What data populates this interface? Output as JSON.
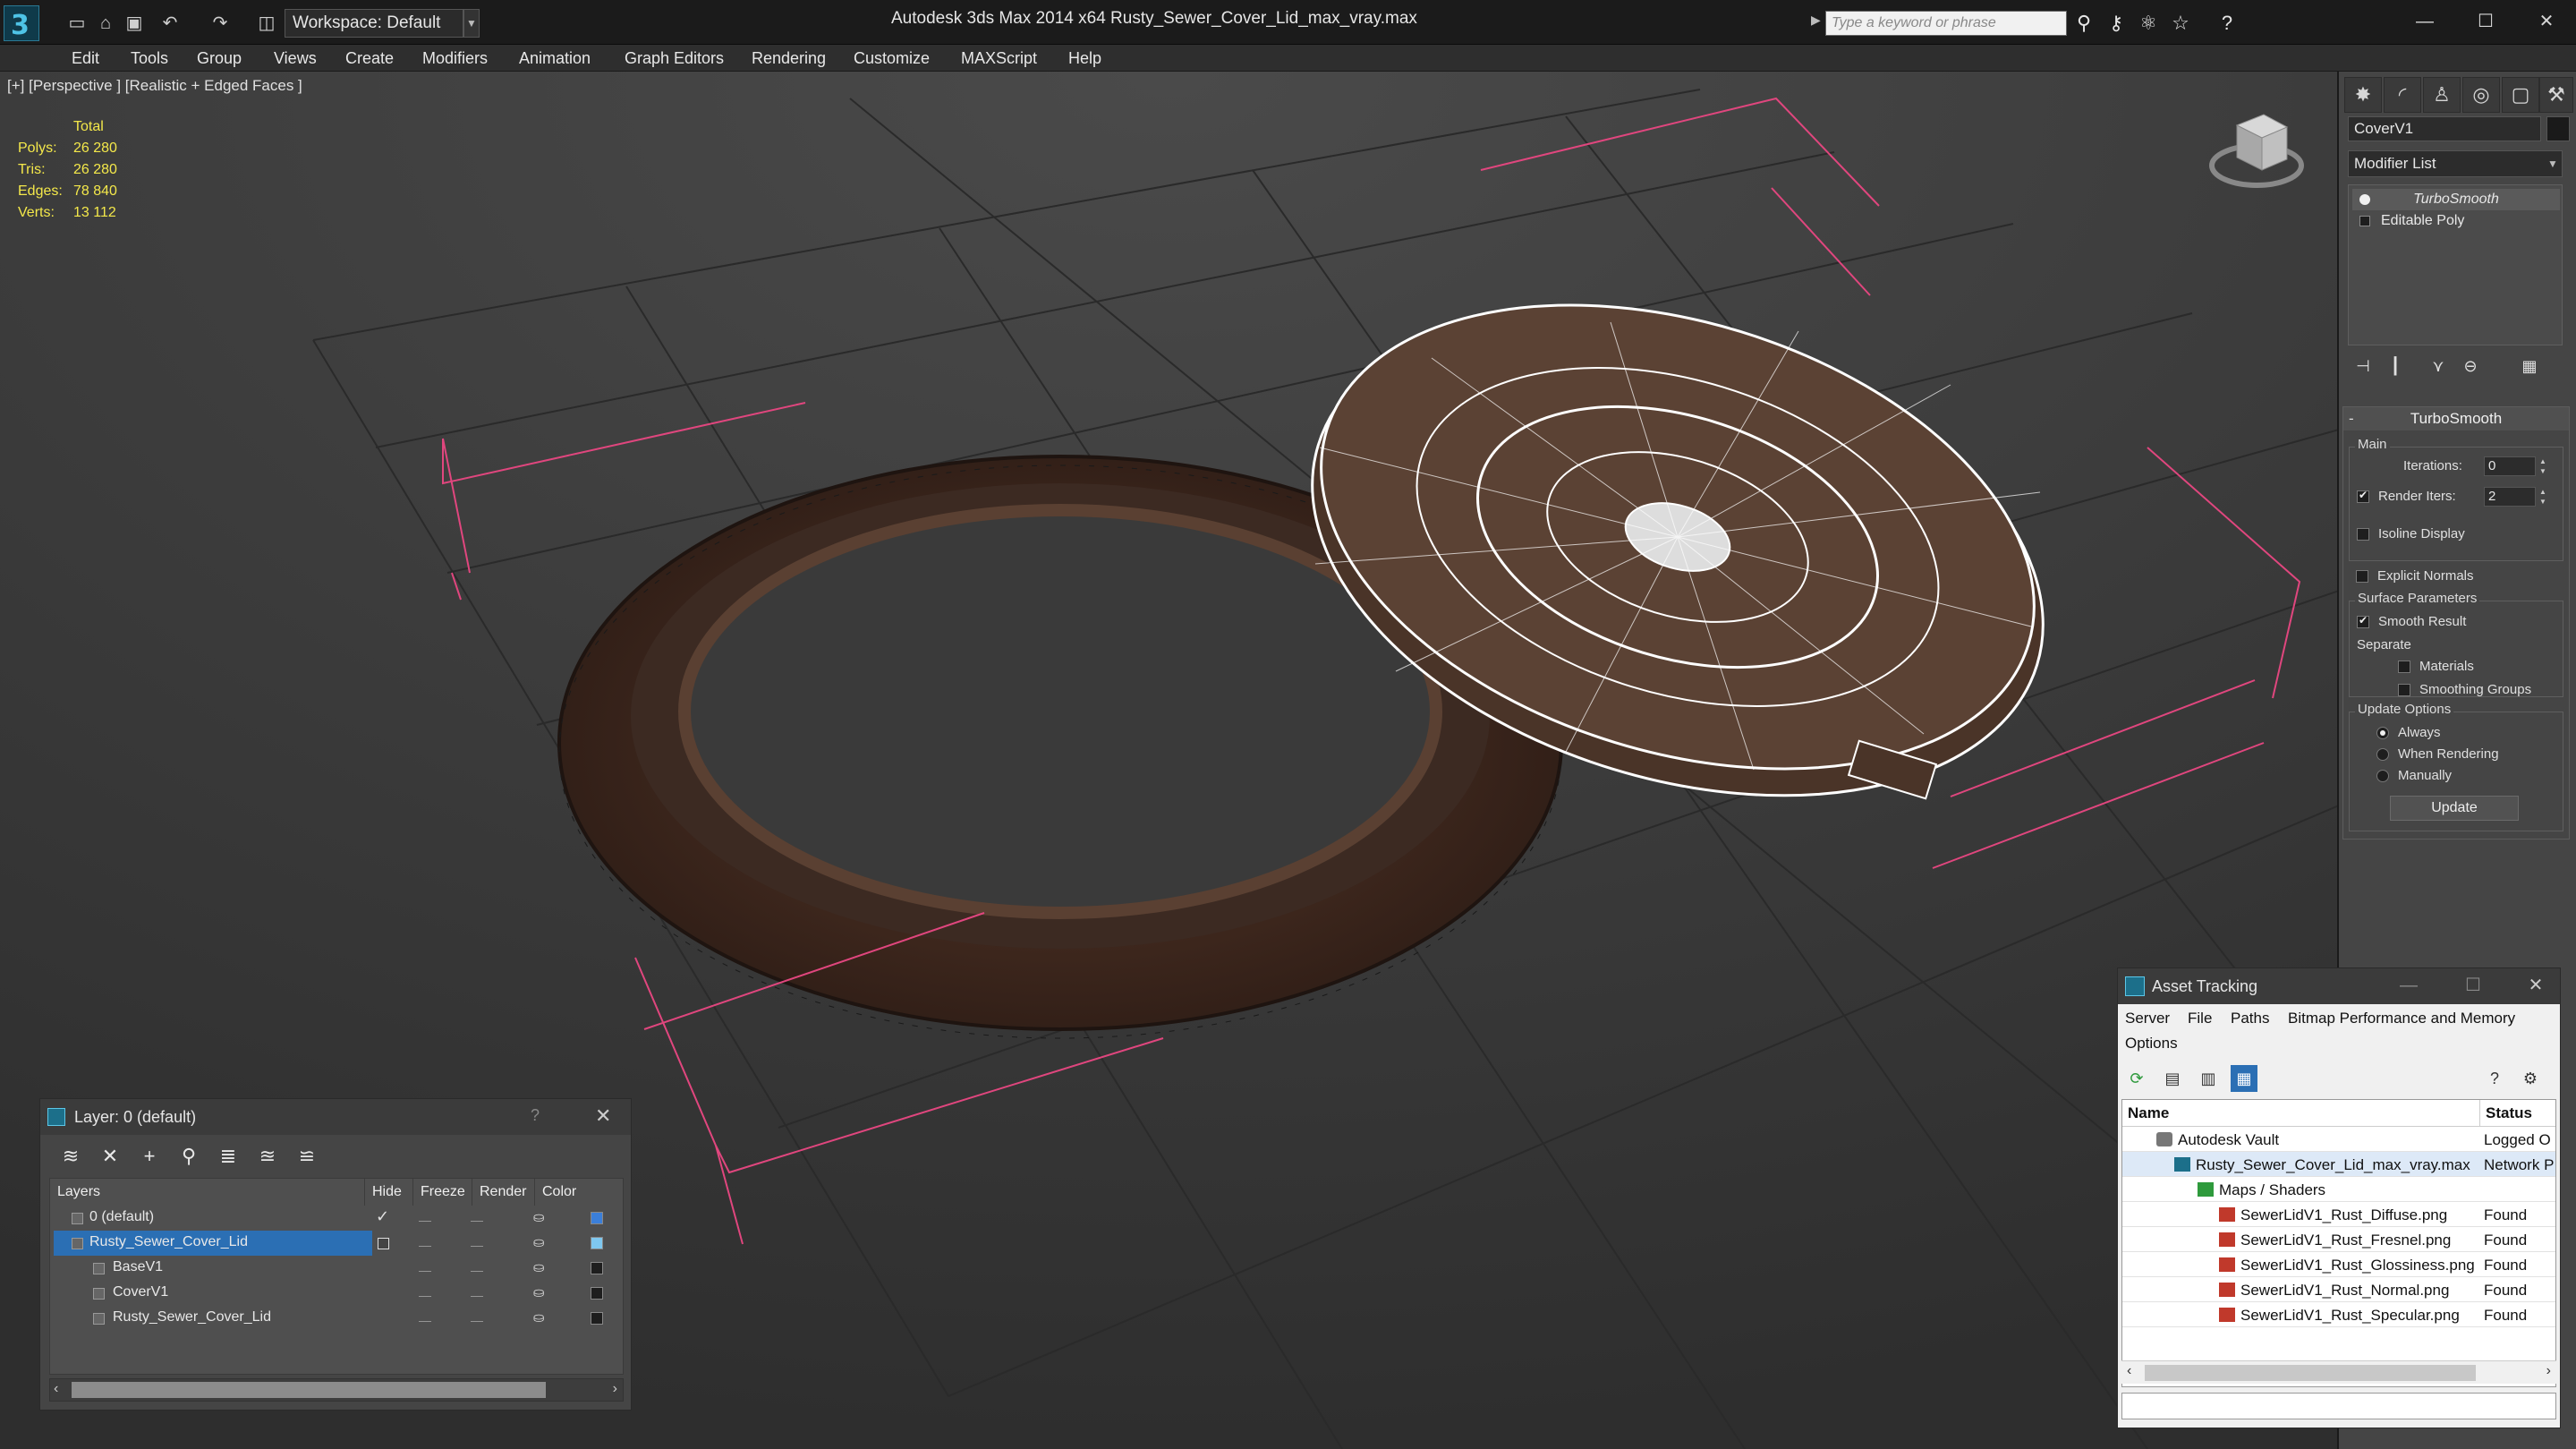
{
  "titlebar": {
    "workspace": "Workspace: Default",
    "app_title": "Autodesk 3ds Max  2014 x64      Rusty_Sewer_Cover_Lid_max_vray.max",
    "search_placeholder": "Type a keyword or phrase"
  },
  "menu": [
    "Edit",
    "Tools",
    "Group",
    "Views",
    "Create",
    "Modifiers",
    "Animation",
    "Graph Editors",
    "Rendering",
    "Customize",
    "MAXScript",
    "Help"
  ],
  "viewport": {
    "label": "[+] [Perspective ] [Realistic + Edged Faces ]",
    "stats": {
      "header": "Total",
      "rows": [
        {
          "key": "Polys:",
          "value": "26 280"
        },
        {
          "key": "Tris:",
          "value": "26 280"
        },
        {
          "key": "Edges:",
          "value": "78 840"
        },
        {
          "key": "Verts:",
          "value": "13 112"
        }
      ]
    }
  },
  "command_panel": {
    "object_name": "CoverV1",
    "modifier_list": "Modifier List",
    "stack": [
      "TurboSmooth",
      "Editable Poly"
    ],
    "rollout": {
      "title": "TurboSmooth",
      "main_label": "Main",
      "iterations_label": "Iterations:",
      "iterations_value": "0",
      "render_iters_label": "Render Iters:",
      "render_iters_value": "2",
      "isoline": "Isoline Display",
      "explicit_normals": "Explicit Normals",
      "surface_label": "Surface Parameters",
      "smooth_result": "Smooth Result",
      "separate_label": "Separate",
      "materials": "Materials",
      "smoothing_groups": "Smoothing Groups",
      "update_label": "Update Options",
      "always": "Always",
      "when_rendering": "When Rendering",
      "manually": "Manually",
      "update_button": "Update"
    }
  },
  "layer_window": {
    "title": "Layer: 0 (default)",
    "help": "?",
    "columns": [
      "Layers",
      "Hide",
      "Freeze",
      "Render",
      "Color"
    ],
    "rows": [
      {
        "name": "0 (default)",
        "color": "#3b7fd9"
      },
      {
        "name": "Rusty_Sewer_Cover_Lid",
        "color": "#7fc8f0"
      },
      {
        "name": "BaseV1",
        "color": "#1e1e1e"
      },
      {
        "name": "CoverV1",
        "color": "#1e1e1e"
      },
      {
        "name": "Rusty_Sewer_Cover_Lid",
        "color": "#1e1e1e"
      }
    ]
  },
  "asset_window": {
    "title": "Asset Tracking",
    "menu": [
      "Server",
      "File",
      "Paths",
      "Bitmap Performance and Memory",
      "Options"
    ],
    "columns": [
      "Name",
      "Status"
    ],
    "rows": [
      {
        "name": "Autodesk Vault",
        "status": "Logged O",
        "icon": "vault-icon"
      },
      {
        "name": "Rusty_Sewer_Cover_Lid_max_vray.max",
        "status": "Network P",
        "icon": "max-file-icon"
      },
      {
        "name": "Maps / Shaders",
        "status": "",
        "icon": "maps-icon"
      },
      {
        "name": "SewerLidV1_Rust_Diffuse.png",
        "status": "Found",
        "icon": "png-icon"
      },
      {
        "name": "SewerLidV1_Rust_Fresnel.png",
        "status": "Found",
        "icon": "png-icon"
      },
      {
        "name": "SewerLidV1_Rust_Glossiness.png",
        "status": "Found",
        "icon": "png-icon"
      },
      {
        "name": "SewerLidV1_Rust_Normal.png",
        "status": "Found",
        "icon": "png-icon"
      },
      {
        "name": "SewerLidV1_Rust_Specular.png",
        "status": "Found",
        "icon": "png-icon"
      }
    ]
  },
  "colors": {
    "accent": "#1c6f8a",
    "selection_bounds": "#e0467e",
    "stats_text": "#f4e84a",
    "wire": "#ffffff"
  }
}
